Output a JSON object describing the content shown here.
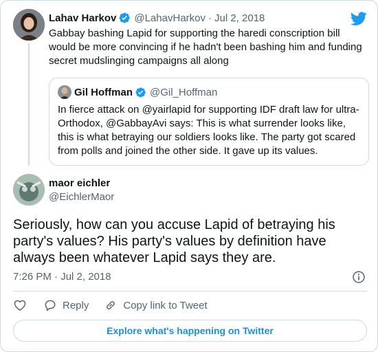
{
  "parent": {
    "name": "Lahav Harkov",
    "handle": "@LahavHarkov",
    "separator": "·",
    "date": "Jul 2, 2018",
    "text": "Gabbay bashing Lapid for supporting the haredi conscription bill would be more convincing if he hadn't been bashing him and funding secret mudslinging campaigns all along"
  },
  "quoted": {
    "name": "Gil Hoffman",
    "handle": "@Gil_Hoffman",
    "text": "In fierce attack on @yairlapid for supporting IDF draft law for ultra-Orthodox, @GabbayAvi says: This is what surrender looks like, this is what betraying our soldiers looks like. The party got scared from polls and joined the other side. It gave up its values."
  },
  "main": {
    "name": "maor eichler",
    "handle": "@EichlerMaor",
    "text": "Seriously, how can you accuse Lapid of betraying his party's values? His party's values by definition have always been whatever Lapid says they are.",
    "timestamp": "7:26 PM · Jul 2, 2018"
  },
  "actions": {
    "reply_label": "Reply",
    "copy_link_label": "Copy link to Tweet"
  },
  "explore_label": "Explore what's happening on Twitter",
  "icons": [
    "twitter-bird-icon",
    "verified-badge-icon",
    "info-icon",
    "heart-icon",
    "reply-icon",
    "link-icon"
  ],
  "colors": {
    "brand": "#1d9bf0",
    "text": "#0f1419",
    "muted": "#536471",
    "border": "#cfd9de",
    "link": "#1d8fd6"
  }
}
